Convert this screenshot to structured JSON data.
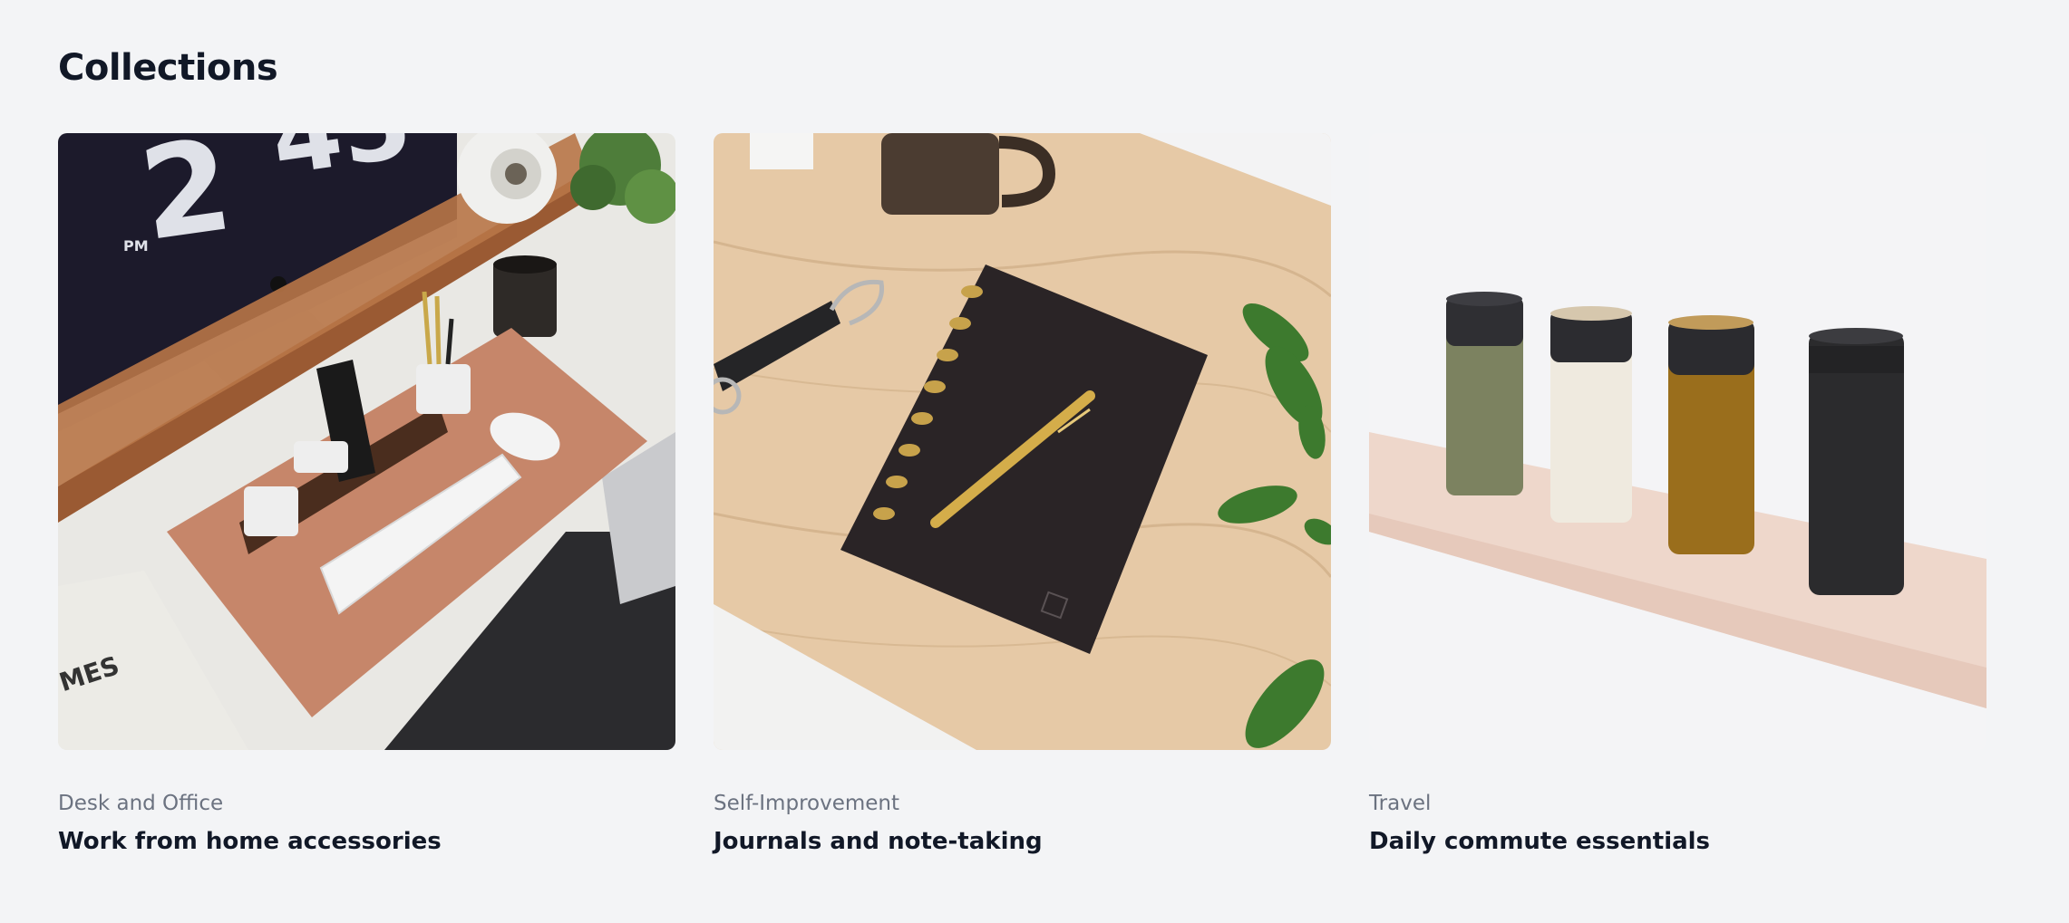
{
  "page": {
    "heading": "Collections"
  },
  "collections": [
    {
      "category": "Desk and Office",
      "title": "Work from home accessories",
      "image": "desk-setup-photo"
    },
    {
      "category": "Self-Improvement",
      "title": "Journals and note-taking",
      "image": "journal-pen-photo"
    },
    {
      "category": "Travel",
      "title": "Daily commute essentials",
      "image": "travel-bottles-photo"
    }
  ],
  "colors": {
    "background": "#f3f4f6",
    "heading": "#111827",
    "category": "#6b7280"
  }
}
